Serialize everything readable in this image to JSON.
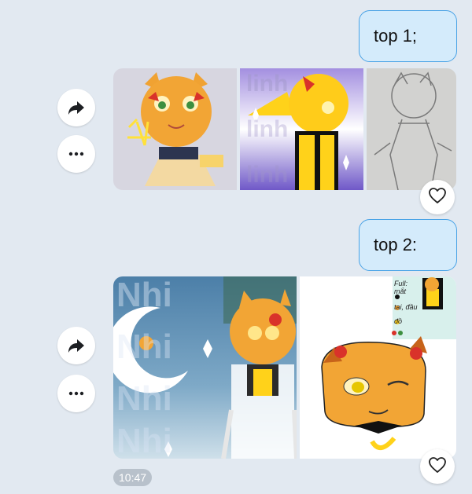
{
  "messages": [
    {
      "text": "top 1;"
    },
    {
      "text": "top 2:"
    }
  ],
  "photo_watermarks": {
    "photo_2": "linh",
    "photo_4": "Nhi"
  },
  "drawing_text": {
    "ref_sheet_1": "Full: ",
    "ref_sheet_2": "mắt",
    "ref_sheet_3": "tai, đầu",
    "ref_sheet_4": "đồ"
  },
  "timestamp": "10:47",
  "icons": {
    "forward": "forward-arrow-icon",
    "more": "more-dots-icon",
    "like": "heart-outline-icon"
  },
  "colors": {
    "background": "#e2e9f1",
    "bubble_fill": "#d4ebfb",
    "bubble_border": "#4aa3e6",
    "timestamp_badge": "#b8c1cb"
  }
}
